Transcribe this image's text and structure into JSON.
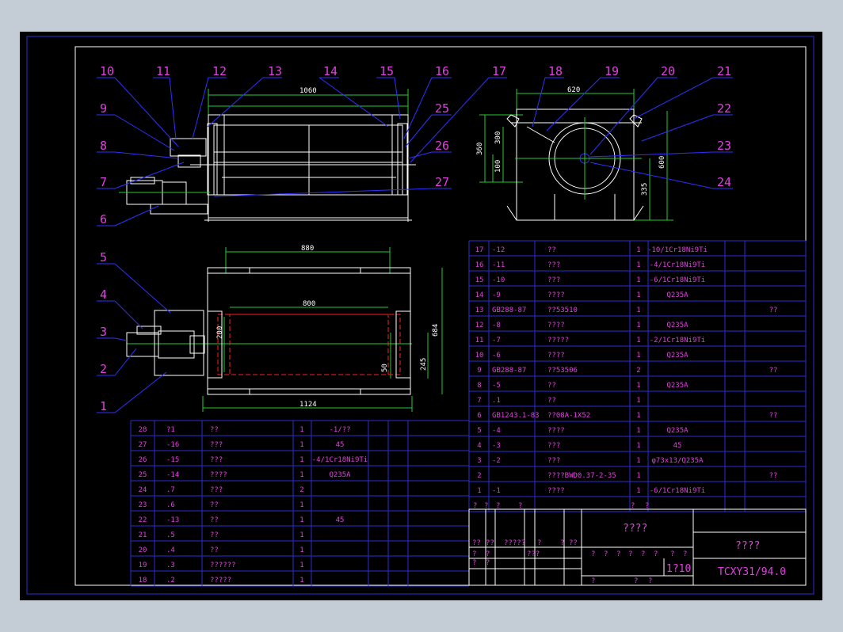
{
  "colors": {
    "background": "#000000",
    "frame": "#2b2bd6",
    "geometry": "#ffffff",
    "dims": "#22cc33",
    "text": "#e040e0",
    "red": "#ff2020",
    "balloon": "#3030ff"
  },
  "balloons": {
    "n10": "10",
    "n11": "11",
    "n12": "12",
    "n13": "13",
    "n14": "14",
    "n15": "15",
    "n16": "16",
    "n17": "17",
    "n18": "18",
    "n19": "19",
    "n20": "20",
    "n21": "21",
    "n22": "22",
    "n23": "23",
    "n24": "24",
    "n25": "25",
    "n26": "26",
    "n27": "27",
    "n9": "9",
    "n8": "8",
    "n7": "7",
    "n6": "6",
    "n5": "5",
    "n4": "4",
    "n3": "3",
    "n2": "2",
    "n1": "1"
  },
  "dims": {
    "d1060": "1060",
    "d880": "880",
    "d800": "800",
    "d1124": "1124",
    "d684": "684",
    "d245": "245",
    "d200": "200",
    "d50": "50",
    "d620": "620",
    "d360": "360",
    "d300": "300",
    "d100": "100",
    "d600": "600",
    "d335": "335"
  },
  "bom_right": [
    [
      "17",
      "-12",
      "??",
      "1",
      "-10/1Cr18Ni9Ti",
      ""
    ],
    [
      "16",
      "-11",
      "???",
      "1",
      "-4/1Cr18Ni9Ti",
      ""
    ],
    [
      "15",
      "-10",
      "???",
      "1",
      "-6/1Cr18Ni9Ti",
      ""
    ],
    [
      "14",
      "-9",
      "????",
      "1",
      "Q235A",
      ""
    ],
    [
      "13",
      "GB288-87",
      "??53510",
      "1",
      "",
      "??"
    ],
    [
      "12",
      "-8",
      "????",
      "1",
      "Q235A",
      ""
    ],
    [
      "11",
      "-7",
      "?????",
      "1",
      "-2/1Cr18Ni9Ti",
      ""
    ],
    [
      "10",
      "-6",
      "????",
      "1",
      "Q235A",
      ""
    ],
    [
      "9",
      "GB288-87",
      "??53506",
      "2",
      "",
      "??"
    ],
    [
      "8",
      "-5",
      "??",
      "1",
      "Q235A",
      ""
    ],
    [
      "7",
      ".1",
      "??",
      "1",
      "",
      ""
    ],
    [
      "6",
      "GB1243.1-83",
      "??08A-1X52",
      "1",
      "",
      "??"
    ],
    [
      "5",
      "-4",
      "????",
      "1",
      "Q235A",
      ""
    ],
    [
      "4",
      "-3",
      "???",
      "1",
      "45",
      ""
    ],
    [
      "3",
      "-2",
      "???",
      "1",
      "φ73x13/Q235A",
      ""
    ],
    [
      "2",
      "",
      "????BWD0.37-2-35",
      "1",
      "",
      "??"
    ],
    [
      "1",
      "-1",
      "????",
      "1",
      "-6/1Cr18Ni9Ti",
      ""
    ]
  ],
  "bom_left": [
    [
      "28",
      "?1",
      "??",
      "1",
      "-1/??"
    ],
    [
      "27",
      "-16",
      "???",
      "1",
      "45"
    ],
    [
      "26",
      "-15",
      "???",
      "1",
      "-4/1Cr18Ni9Ti"
    ],
    [
      "25",
      "-14",
      "????",
      "1",
      "Q235A"
    ],
    [
      "24",
      ".7",
      "???",
      "2",
      ""
    ],
    [
      "23",
      ".6",
      "??",
      "1",
      ""
    ],
    [
      "22",
      "-13",
      "??",
      "1",
      "45"
    ],
    [
      "21",
      ".5",
      "??",
      "1",
      ""
    ],
    [
      "20",
      ".4",
      "??",
      "1",
      ""
    ],
    [
      "19",
      ".3",
      "??????",
      "1",
      ""
    ],
    [
      "18",
      ".2",
      "?????",
      "1",
      ""
    ]
  ],
  "header_row": [
    "?",
    "?",
    "?",
    "?",
    "?",
    "?"
  ],
  "title_block": {
    "drawing_name": "????",
    "company": "????",
    "drawing_no": "TCXY31/94.0",
    "scale": "1?10",
    "sig_row1": [
      "??",
      "??",
      "?????",
      "?",
      "?",
      "??"
    ],
    "sig_row2": [
      "?",
      "?",
      "???"
    ],
    "stage_cells": [
      "?",
      "?",
      "?",
      "?",
      "?",
      "?",
      "?",
      "?"
    ],
    "bottom_cells": [
      "?",
      "?",
      "?",
      "?",
      "?"
    ]
  }
}
